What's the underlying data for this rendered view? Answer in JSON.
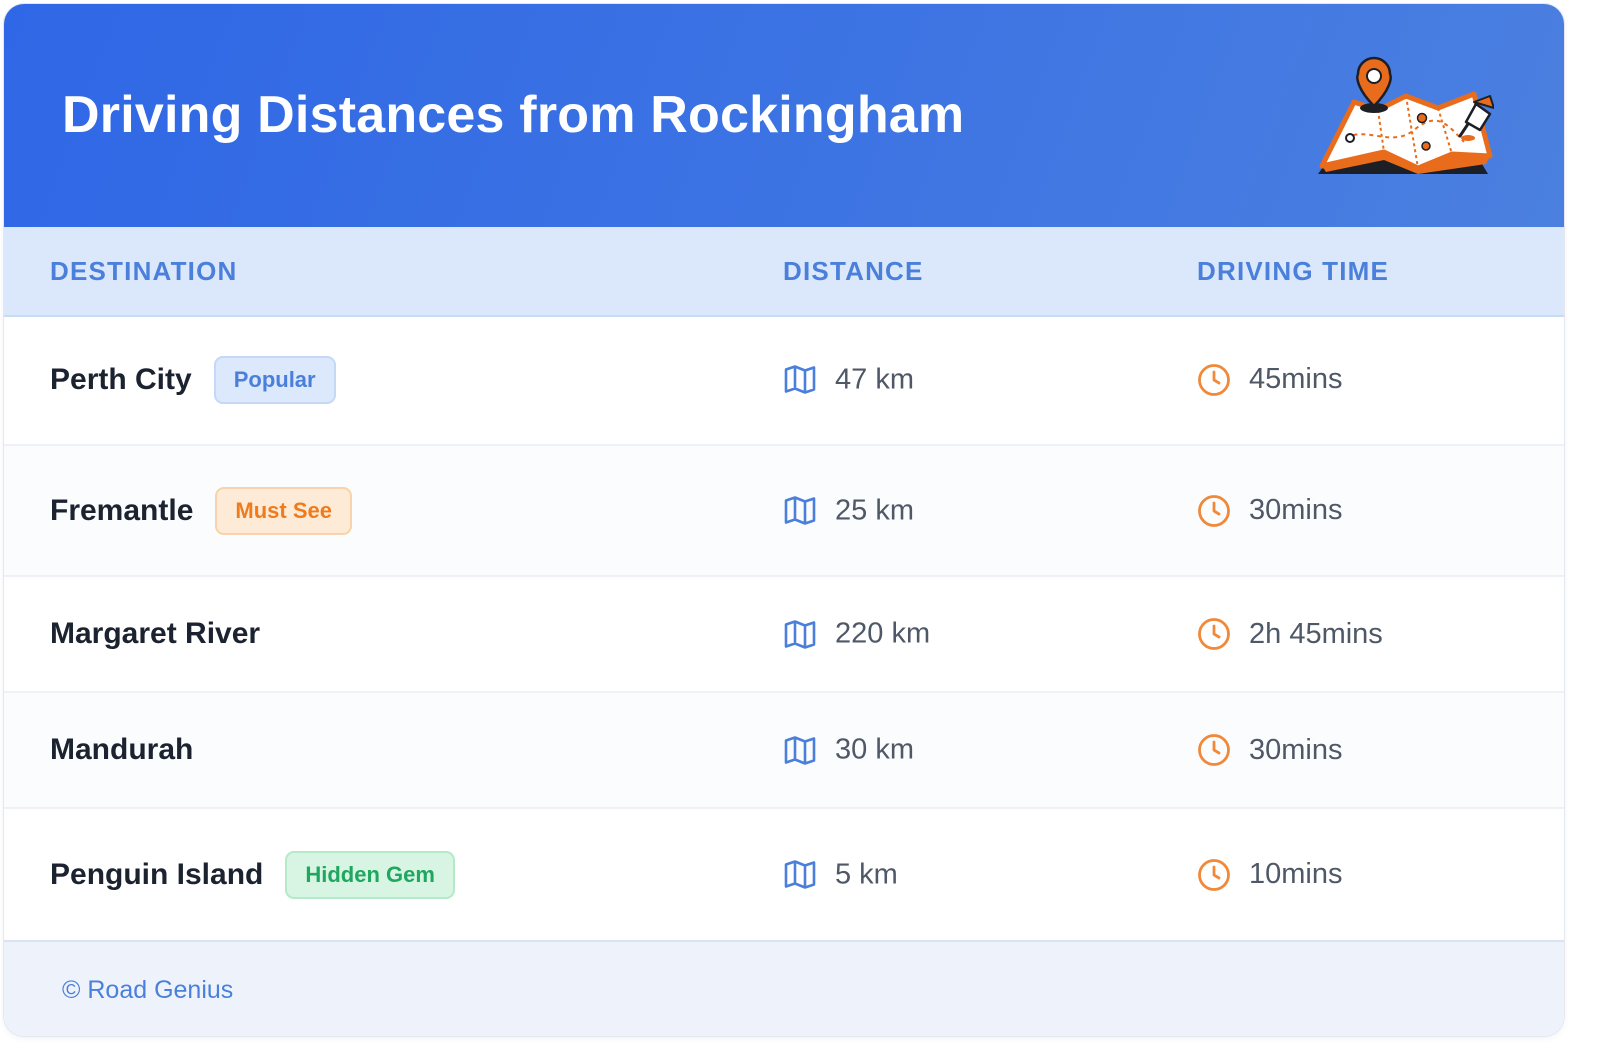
{
  "header": {
    "title": "Driving Distances from Rockingham",
    "illustration_icon": "map-with-pins-icon"
  },
  "columns": {
    "destination": "DESTINATION",
    "distance": "DISTANCE",
    "driving_time": "DRIVING TIME"
  },
  "rows": [
    {
      "destination": "Perth City",
      "badge": "Popular",
      "badge_style": "popular",
      "distance": "47 km",
      "time": "45mins"
    },
    {
      "destination": "Fremantle",
      "badge": "Must See",
      "badge_style": "must-see",
      "distance": "25 km",
      "time": "30mins"
    },
    {
      "destination": "Margaret River",
      "badge": null,
      "badge_style": null,
      "distance": "220 km",
      "time": "2h 45mins"
    },
    {
      "destination": "Mandurah",
      "badge": null,
      "badge_style": null,
      "distance": "30 km",
      "time": "30mins"
    },
    {
      "destination": "Penguin Island",
      "badge": "Hidden Gem",
      "badge_style": "hidden-gem",
      "distance": "5 km",
      "time": "10mins"
    }
  ],
  "icons": {
    "distance": "map-icon",
    "time": "clock-icon"
  },
  "badge_styles": {
    "popular": {
      "bg": "#dce8fb",
      "border": "#c5d8f6",
      "text": "#4a7fdb"
    },
    "must-see": {
      "bg": "#fdebd7",
      "border": "#f8d2a8",
      "text": "#ef7b1d"
    },
    "hidden-gem": {
      "bg": "#d8f5e4",
      "border": "#b5e9c9",
      "text": "#1fa760"
    }
  },
  "colors": {
    "header_gradient_start": "#2f67e6",
    "header_gradient_end": "#4b80e0",
    "accent_blue": "#4a7fdb",
    "accent_orange": "#f0893a"
  },
  "footer": {
    "text": "© Road Genius"
  }
}
